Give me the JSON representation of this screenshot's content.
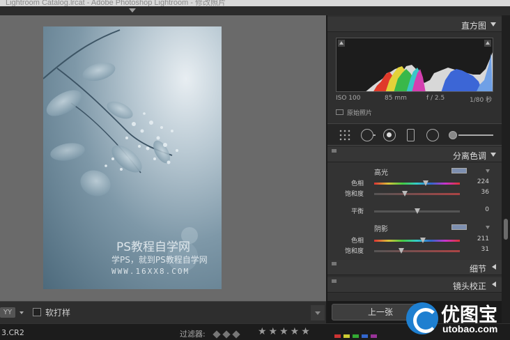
{
  "window": {
    "title": "Lightroom Catalog.lrcat - Adobe Photoshop Lightroom - 修改照片"
  },
  "photo": {
    "watermark_title": "PS教程自学网",
    "watermark_sub": "学PS，就到PS教程自学网",
    "watermark_url": "WWW.16XX8.COM"
  },
  "toolbar": {
    "view_mode": "YY",
    "soft_proof_label": "软打样"
  },
  "filmstrip": {
    "filename": "3.CR2",
    "filter_label": "过滤器:",
    "stars": "★★★★★"
  },
  "histogram": {
    "title": "直方图",
    "iso": "ISO 100",
    "focal": "85 mm",
    "aperture": "f / 2.5",
    "shutter": "1/80 秒",
    "original_photo_label": "原始照片"
  },
  "split_toning": {
    "title": "分离色调",
    "highlights": {
      "label": "高光",
      "hue_label": "色相",
      "hue_value": "224",
      "hue_pos": 0.6,
      "sat_label": "饱和度",
      "sat_value": "36",
      "sat_pos": 0.36,
      "swatch_color": "#7d8fb0"
    },
    "balance": {
      "label": "平衡",
      "value": "0",
      "pos": 0.5
    },
    "shadows": {
      "label": "阴影",
      "hue_label": "色相",
      "hue_value": "211",
      "hue_pos": 0.57,
      "sat_label": "饱和度",
      "sat_value": "31",
      "sat_pos": 0.32,
      "swatch_color": "#7d8fb0"
    }
  },
  "sections": {
    "detail": "细节",
    "lens_correction": "镜头校正"
  },
  "nav": {
    "previous_label": "上一张"
  },
  "logo": {
    "name": "优图宝",
    "url": "utobao.com"
  }
}
